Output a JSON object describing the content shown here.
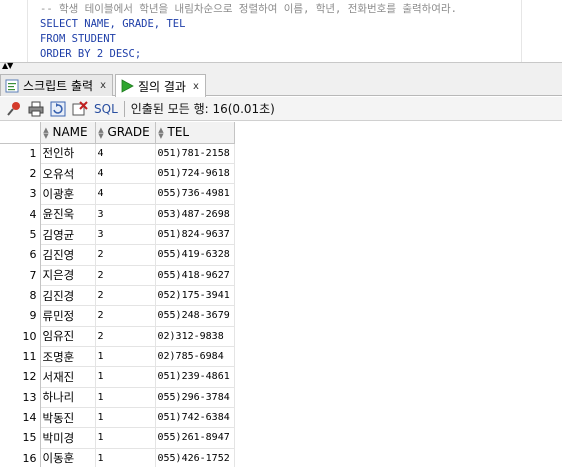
{
  "editor": {
    "comment_line": "-- 학생 테이블에서 학년을 내림차순으로 정렬하여 이름, 학년, 전화번호를 출력하여라.",
    "select_kw": "SELECT",
    "select_rest": " NAME, GRADE, TEL",
    "from_kw": "FROM",
    "from_rest": " STUDENT",
    "order_kw": "ORDER BY",
    "order_rest": " 2 DESC;"
  },
  "tabs": [
    {
      "label": "스크립트 출력",
      "close": "x",
      "icon": "script-output-icon"
    },
    {
      "label": "질의 결과",
      "close": "x",
      "icon": "run-query-icon"
    }
  ],
  "toolbar": {
    "icons": [
      "pin-icon",
      "print-icon",
      "refresh-icon",
      "clear-icon"
    ],
    "sql_label": "SQL",
    "status": "인출된 모든 행: 16(0.01초)"
  },
  "grid": {
    "columns": [
      "NAME",
      "GRADE",
      "TEL"
    ],
    "rows": [
      {
        "num": "1",
        "name": "전인하",
        "grade": "4",
        "tel": "051)781-2158"
      },
      {
        "num": "2",
        "name": "오유석",
        "grade": "4",
        "tel": "051)724-9618"
      },
      {
        "num": "3",
        "name": "이광훈",
        "grade": "4",
        "tel": "055)736-4981"
      },
      {
        "num": "4",
        "name": "윤진욱",
        "grade": "3",
        "tel": "053)487-2698"
      },
      {
        "num": "5",
        "name": "김영균",
        "grade": "3",
        "tel": "051)824-9637"
      },
      {
        "num": "6",
        "name": "김진영",
        "grade": "2",
        "tel": "055)419-6328"
      },
      {
        "num": "7",
        "name": "지은경",
        "grade": "2",
        "tel": "055)418-9627"
      },
      {
        "num": "8",
        "name": "김진경",
        "grade": "2",
        "tel": "052)175-3941"
      },
      {
        "num": "9",
        "name": "류민정",
        "grade": "2",
        "tel": "055)248-3679"
      },
      {
        "num": "10",
        "name": "임유진",
        "grade": "2",
        "tel": "02)312-9838"
      },
      {
        "num": "11",
        "name": "조명훈",
        "grade": "1",
        "tel": "02)785-6984"
      },
      {
        "num": "12",
        "name": "서재진",
        "grade": "1",
        "tel": "051)239-4861"
      },
      {
        "num": "13",
        "name": "하나리",
        "grade": "1",
        "tel": "055)296-3784"
      },
      {
        "num": "14",
        "name": "박동진",
        "grade": "1",
        "tel": "051)742-6384"
      },
      {
        "num": "15",
        "name": "박미경",
        "grade": "1",
        "tel": "055)261-8947"
      },
      {
        "num": "16",
        "name": "이동훈",
        "grade": "1",
        "tel": "055)426-1752"
      }
    ]
  }
}
